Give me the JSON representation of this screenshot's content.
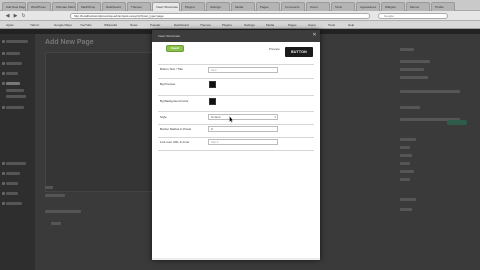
{
  "browser": {
    "tabs": [
      {
        "label": "Add New Page"
      },
      {
        "label": "WordPress"
      },
      {
        "label": "Ultimate Shortcodes"
      },
      {
        "label": "MailChimp"
      },
      {
        "label": "Dashboard"
      },
      {
        "label": "Themes"
      },
      {
        "label": "Insert Shortcode"
      },
      {
        "label": "Plugins"
      },
      {
        "label": "Settings"
      },
      {
        "label": "Media"
      },
      {
        "label": "Pages"
      },
      {
        "label": "Comments"
      },
      {
        "label": "Users"
      },
      {
        "label": "Tools"
      },
      {
        "label": "Appearance"
      },
      {
        "label": "Widgets"
      },
      {
        "label": "Menus"
      },
      {
        "label": "Profile"
      }
    ],
    "url": "http://localhost/wordpress/wp-admin/post-new.php?post_type=page",
    "search_placeholder": "Google",
    "nav": {
      "back": "◀",
      "forward": "▶",
      "reload": "↻"
    },
    "bookmarks": [
      "Apple",
      "Yahoo!",
      "Google Maps",
      "YouTube",
      "Wikipedia",
      "News",
      "Popular",
      "Dashboard",
      "Themes",
      "Plugins",
      "Settings",
      "Media",
      "Pages",
      "Users",
      "Tools",
      "Help"
    ]
  },
  "wp": {
    "page_title": "Add New Page"
  },
  "modal": {
    "title": "Insert Shortcode",
    "close_icon": "✕",
    "insert_label": "Insert",
    "preview_label": "Preview",
    "preview_button_label": "BUTTON",
    "rows": [
      {
        "label": "Button Text / Title",
        "type": "text",
        "value": "Text"
      },
      {
        "label": "Bg Preview",
        "type": "color",
        "value": "#111111"
      },
      {
        "label": "Bg Background Color",
        "type": "color",
        "value": "#111111"
      },
      {
        "label": "Style",
        "type": "select",
        "value": "Default"
      },
      {
        "label": "Border Radius in Pixels",
        "type": "text",
        "value": "0"
      },
      {
        "label": "Link over URL & Inner",
        "type": "text",
        "value": "http://"
      }
    ]
  },
  "colors": {
    "insert_green": "#8bc34a",
    "preview_button_bg": "#1a1a1a",
    "modal_header": "#3c3c3c"
  }
}
